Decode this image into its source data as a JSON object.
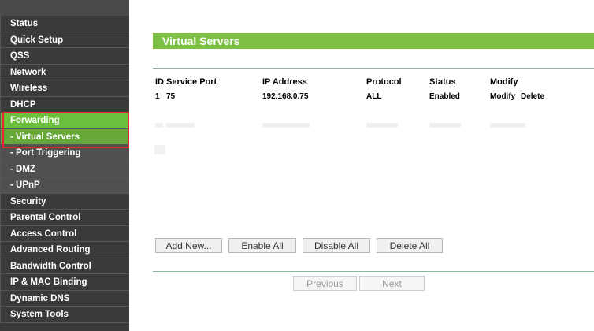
{
  "sidebar": {
    "items": [
      {
        "label": "Status",
        "sub": false
      },
      {
        "label": "Quick Setup",
        "sub": false
      },
      {
        "label": "QSS",
        "sub": false
      },
      {
        "label": "Network",
        "sub": false
      },
      {
        "label": "Wireless",
        "sub": false
      },
      {
        "label": "DHCP",
        "sub": false
      },
      {
        "label": "Forwarding",
        "sub": false,
        "active": true
      },
      {
        "label": "- Virtual Servers",
        "sub": true,
        "active": true
      },
      {
        "label": "- Port Triggering",
        "sub": true
      },
      {
        "label": "- DMZ",
        "sub": true
      },
      {
        "label": "- UPnP",
        "sub": true
      },
      {
        "label": "Security",
        "sub": false
      },
      {
        "label": "Parental Control",
        "sub": false
      },
      {
        "label": "Access Control",
        "sub": false
      },
      {
        "label": "Advanced Routing",
        "sub": false
      },
      {
        "label": "Bandwidth Control",
        "sub": false
      },
      {
        "label": "IP & MAC Binding",
        "sub": false
      },
      {
        "label": "Dynamic DNS",
        "sub": false
      },
      {
        "label": "System Tools",
        "sub": false
      }
    ]
  },
  "main": {
    "title": "Virtual Servers",
    "table": {
      "headers": {
        "id": "ID",
        "service_port": "Service Port",
        "ip_address": "IP Address",
        "protocol": "Protocol",
        "status": "Status",
        "modify": "Modify"
      },
      "rows": [
        {
          "id": "1",
          "service_port": "75",
          "ip_address": "192.168.0.75",
          "protocol": "ALL",
          "status": "Enabled",
          "modify_label": "Modify",
          "delete_label": "Delete"
        }
      ]
    },
    "buttons": {
      "add_new": "Add New...",
      "enable_all": "Enable All",
      "disable_all": "Disable All",
      "delete_all": "Delete All",
      "previous": "Previous",
      "next": "Next"
    }
  },
  "colors": {
    "accent_green": "#7cc143",
    "sidebar_bg": "#3a3a3a",
    "highlight_red": "#e6262a"
  }
}
